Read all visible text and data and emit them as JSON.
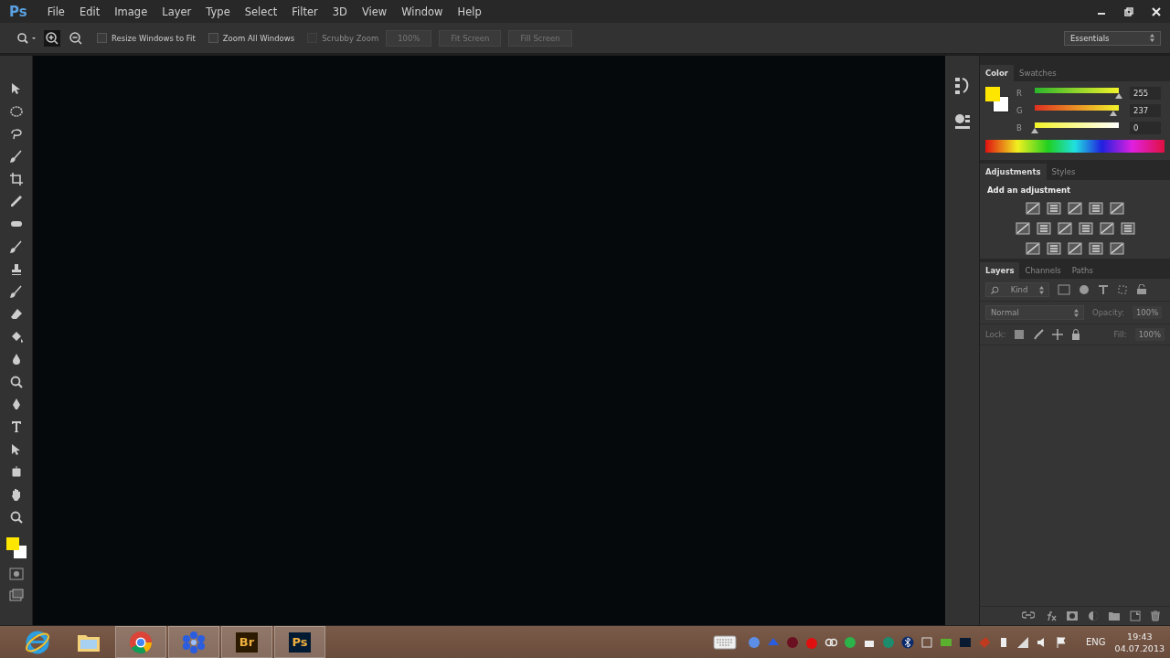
{
  "app_logo": "Ps",
  "menu": [
    "File",
    "Edit",
    "Image",
    "Layer",
    "Type",
    "Select",
    "Filter",
    "3D",
    "View",
    "Window",
    "Help"
  ],
  "options_bar": {
    "checkboxes": [
      {
        "label": "Resize Windows to Fit",
        "checked": false,
        "disabled": false
      },
      {
        "label": "Zoom All Windows",
        "checked": false,
        "disabled": false
      },
      {
        "label": "Scrubby Zoom",
        "checked": false,
        "disabled": true
      }
    ],
    "buttons": [
      "100%",
      "Fit Screen",
      "Fill Screen"
    ],
    "workspace": "Essentials"
  },
  "color_panel": {
    "tabs": [
      {
        "label": "Color",
        "selected": true
      },
      {
        "label": "Swatches",
        "selected": false
      }
    ],
    "channels": [
      {
        "label": "R",
        "level": 1.0,
        "reading": "255"
      },
      {
        "label": "G",
        "level": 0.93,
        "reading": "237"
      },
      {
        "label": "B",
        "level": 0.0,
        "reading": "0"
      }
    ]
  },
  "adjustments_panel": {
    "tabs": [
      {
        "label": "Adjustments",
        "selected": true
      },
      {
        "label": "Styles",
        "selected": false
      }
    ],
    "heading": "Add an adjustment"
  },
  "layers_panel": {
    "tabs": [
      {
        "label": "Layers",
        "selected": true
      },
      {
        "label": "Channels",
        "selected": false
      },
      {
        "label": "Paths",
        "selected": false
      }
    ],
    "filter": "Kind",
    "blend_mode": "Normal",
    "opacity_label": "Opacity:",
    "opacity": "100%",
    "lock_label": "Lock:",
    "fill_label": "Fill:",
    "fill": "100%"
  },
  "taskbar": {
    "apps": [
      {
        "kind": "ie",
        "running": false
      },
      {
        "kind": "folder",
        "running": false
      },
      {
        "kind": "chrome",
        "running": true
      },
      {
        "kind": "flower",
        "running": true
      },
      {
        "kind": "badge",
        "text": "Br",
        "running": true
      },
      {
        "kind": "badge",
        "text": "Ps",
        "running": true
      }
    ],
    "language": "ENG",
    "time": "19:43",
    "date": "04.07.2013"
  }
}
